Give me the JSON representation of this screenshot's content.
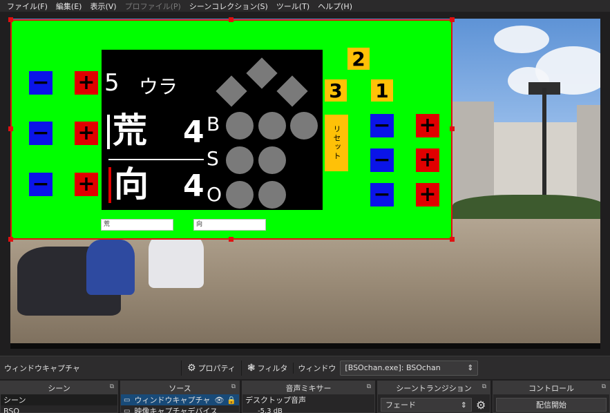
{
  "menu": {
    "items": [
      {
        "label": "ファイル(F)",
        "enabled": true
      },
      {
        "label": "編集(E)",
        "enabled": true
      },
      {
        "label": "表示(V)",
        "enabled": true
      },
      {
        "label": "プロファイル(P)",
        "enabled": false
      },
      {
        "label": "シーンコレクション(S)",
        "enabled": true
      },
      {
        "label": "ツール(T)",
        "enabled": true
      },
      {
        "label": "ヘルプ(H)",
        "enabled": true
      }
    ]
  },
  "scoreboard": {
    "inning": "5",
    "half": "ウラ",
    "top_team": "荒",
    "bottom_team": "向",
    "top_score": "4",
    "bottom_score": "4",
    "labels": {
      "ball": "B",
      "strike": "S",
      "out": "O"
    },
    "count": {
      "balls": 0,
      "strikes": 0,
      "outs": 0
    },
    "runner_buttons": {
      "first": "1",
      "second": "2",
      "third": "3"
    },
    "reset_label": "リセット",
    "top_team_input": "荒",
    "bottom_team_input": "向",
    "plus_symbol": "+",
    "minus_symbol": "−",
    "colors": {
      "background": "#00ff00",
      "minus": "#0a14e8",
      "plus": "#e00000",
      "accent": "#ffc107",
      "selection_border": "#e01010"
    }
  },
  "properties_bar": {
    "source_name": "ウィンドウキャプチャ",
    "properties_label": "プロパティ",
    "filters_label": "フィルタ",
    "window_label": "ウィンドウ",
    "window_value": "[BSOchan.exe]: BSOchan"
  },
  "docks": {
    "scenes": {
      "title": "シーン",
      "items": [
        "シーン",
        "BSO"
      ]
    },
    "sources": {
      "title": "ソース",
      "items": [
        "ウィンドウキャプチャ",
        "映像キャプチャデバイス"
      ]
    },
    "mixer": {
      "title": "音声ミキサー",
      "channel": "デスクトップ音声",
      "level": "-5.3 dB"
    },
    "transitions": {
      "title": "シーントランジション",
      "selected": "フェード"
    },
    "controls": {
      "title": "コントロール",
      "start_streaming": "配信開始"
    }
  }
}
